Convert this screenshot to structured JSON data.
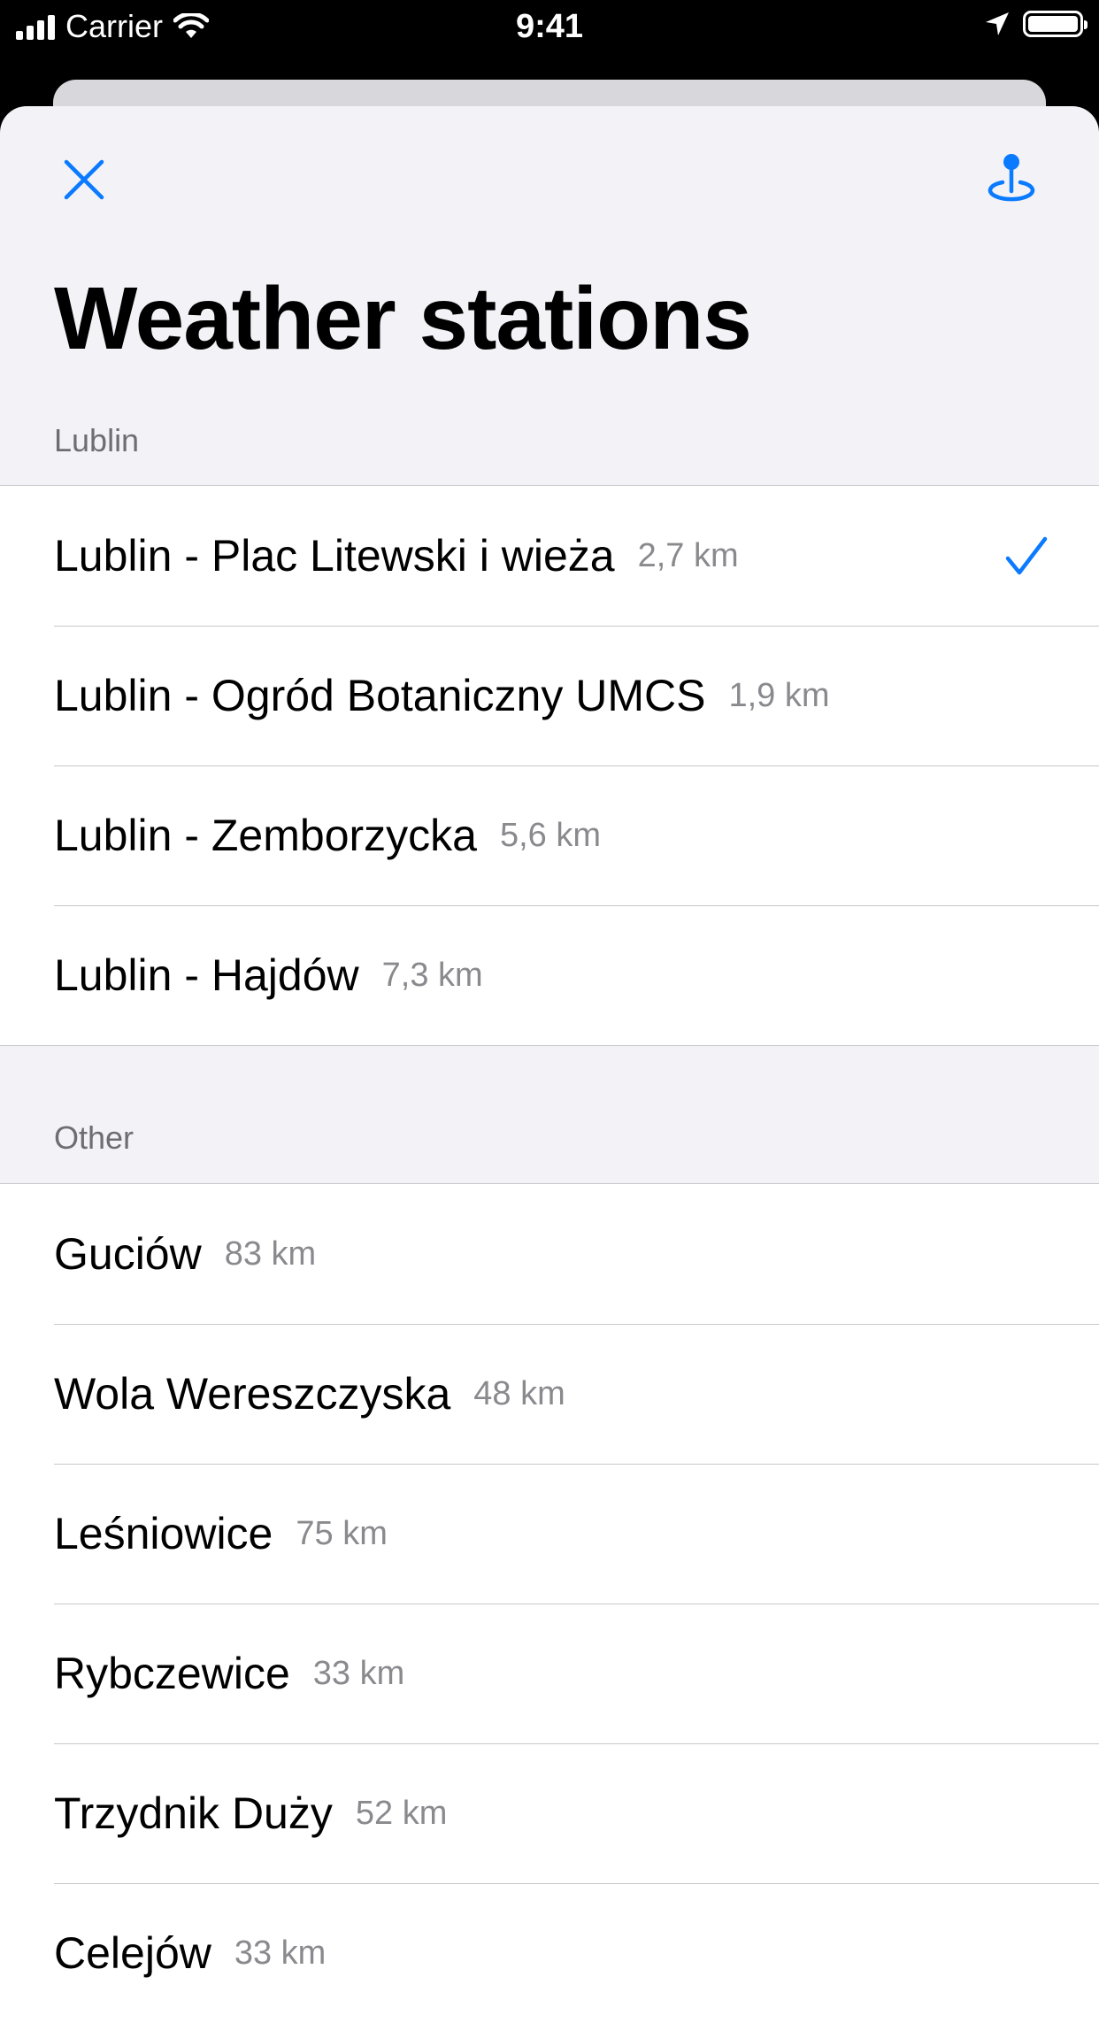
{
  "status_bar": {
    "carrier": "Carrier",
    "time": "9:41"
  },
  "nav": {
    "close_icon": "close-icon",
    "location_icon": "location-pin-icon"
  },
  "title": "Weather stations",
  "sections": [
    {
      "header": "Lublin",
      "items": [
        {
          "name": "Lublin - Plac Litewski i wieża",
          "distance": "2,7 km",
          "selected": true
        },
        {
          "name": "Lublin - Ogród Botaniczny UMCS",
          "distance": "1,9 km",
          "selected": false
        },
        {
          "name": "Lublin - Zemborzycka",
          "distance": "5,6 km",
          "selected": false
        },
        {
          "name": "Lublin - Hajdów",
          "distance": "7,3 km",
          "selected": false
        }
      ]
    },
    {
      "header": "Other",
      "items": [
        {
          "name": "Guciów",
          "distance": "83 km"
        },
        {
          "name": "Wola Wereszczyska",
          "distance": "48 km"
        },
        {
          "name": "Leśniowice",
          "distance": "75 km"
        },
        {
          "name": "Rybczewice",
          "distance": "33 km"
        },
        {
          "name": "Trzydnik Duży",
          "distance": "52 km"
        },
        {
          "name": "Celejów",
          "distance": "33 km"
        }
      ]
    }
  ],
  "colors": {
    "accent": "#0a7aff",
    "background": "#f2f2f7",
    "secondary_text": "#8a8a8e"
  }
}
